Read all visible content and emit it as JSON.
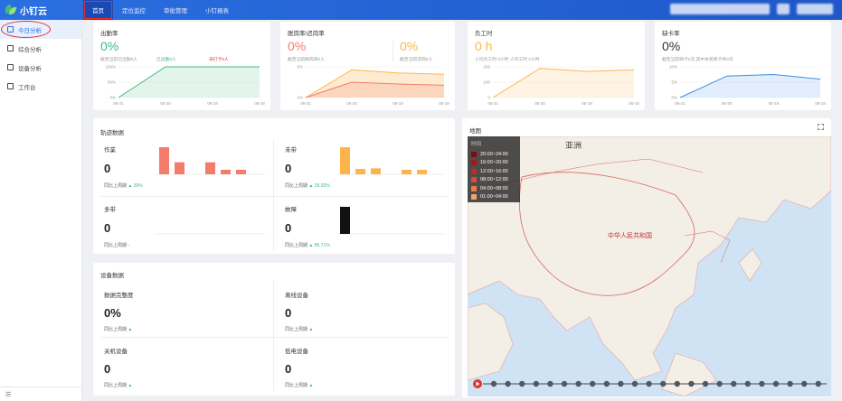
{
  "app": {
    "name": "小钉云"
  },
  "nav": [
    "首页",
    "定位监控",
    "审批管理",
    "小钉报表"
  ],
  "sidebar": {
    "items": [
      "今日分析",
      "综合分析",
      "设备分析",
      "工作台"
    ],
    "footer": "☰"
  },
  "cards": {
    "attendance": {
      "title": "出勤率",
      "value": "0%",
      "sub": [
        "截至当前已出勤0人",
        "已出勤0人",
        "未打卡0人"
      ],
      "chart_data": {
        "type": "area",
        "categories": [
          "06-21",
          "06-20",
          "06-19",
          "06-18"
        ],
        "ylabels": [
          "100%",
          "50%",
          "0%"
        ],
        "series": [
          {
            "values": [
              0,
              100,
              100,
              100
            ]
          }
        ]
      }
    },
    "leave": {
      "title": "脱岗率/迟岗率",
      "value": "0%",
      "value2": "0%",
      "sub": "截至当前脱岗率0人",
      "sub2": "截至当前迟岗0人",
      "chart_data": {
        "type": "area",
        "categories": [
          "06-21",
          "06-20",
          "06-19",
          "06-18"
        ],
        "ylabels": [
          "5%",
          "0%"
        ],
        "series": [
          {
            "values": [
              0,
              4.5,
              4,
              3.8
            ]
          },
          {
            "values": [
              0,
              2.5,
              2.2,
              2
            ]
          }
        ]
      }
    },
    "hours": {
      "title": "负工时",
      "value": "0 h",
      "sub": "人均负工时 0小时 人均工时 0小时",
      "chart_data": {
        "type": "area",
        "categories": [
          "06-21",
          "06-20",
          "06-19",
          "06-18"
        ],
        "ylabels": [
          "200",
          "100",
          "0"
        ],
        "series": [
          {
            "values": [
              0,
              190,
              170,
              180
            ]
          }
        ]
      }
    },
    "missing": {
      "title": "缺卡率",
      "value": "0%",
      "sub": "截至当前缺卡0次,其中关机缺卡共0次",
      "chart_data": {
        "type": "area",
        "categories": [
          "06-21",
          "06-20",
          "06-19",
          "06-18"
        ],
        "ylabels": [
          "10%",
          "5%",
          "0%"
        ],
        "series": [
          {
            "values": [
              0,
              7,
              7.5,
              6
            ]
          }
        ]
      }
    }
  },
  "behavior": {
    "title": "轨迹数据",
    "items": [
      {
        "label": "作業",
        "value": "0",
        "cmp": "同比上周期",
        "pct": "30%",
        "color": "#f47c6a",
        "bars": [
          9,
          4,
          0,
          4,
          1.5,
          1.5
        ]
      },
      {
        "label": "未带",
        "value": "0",
        "cmp": "同比上周期",
        "pct": "29.92%",
        "color": "#fdb54b",
        "bars": [
          9,
          1.8,
          2,
          0,
          1.5,
          1.5
        ]
      },
      {
        "label": "多带",
        "value": "0",
        "cmp": "同比上周期 -",
        "pct": "",
        "color": "#9bb",
        "bars": []
      },
      {
        "label": "故障",
        "value": "0",
        "cmp": "同比上周期",
        "pct": "85.71%",
        "color": "#111",
        "bars": [
          9,
          0,
          0,
          0,
          0,
          0
        ]
      }
    ]
  },
  "device": {
    "title": "设备数据",
    "items": [
      {
        "label": "数据完整度",
        "value": "0%",
        "cmp": "同比上周期"
      },
      {
        "label": "离线设备",
        "value": "0",
        "cmp": "同比上周期"
      },
      {
        "label": "关机设备",
        "value": "0",
        "cmp": "同比上周期"
      },
      {
        "label": "低电设备",
        "value": "0",
        "cmp": "同比上周期"
      }
    ]
  },
  "map": {
    "title": "地图",
    "labels": {
      "asia": "亚洲",
      "china": "中华人民共和国"
    },
    "legend": {
      "title": "时间",
      "items": [
        "20:00~24:00",
        "16:00~20:00",
        "12:00~16:00",
        "08:00~12:00",
        "04:00~08:00",
        "01:00~04:00"
      ],
      "colors": [
        "#7a0d12",
        "#a3161b",
        "#c22a22",
        "#d94b36",
        "#ea7a4e",
        "#f3a364"
      ]
    }
  },
  "colors": {
    "green": "#41b883",
    "accent": "#2a6fe0"
  }
}
